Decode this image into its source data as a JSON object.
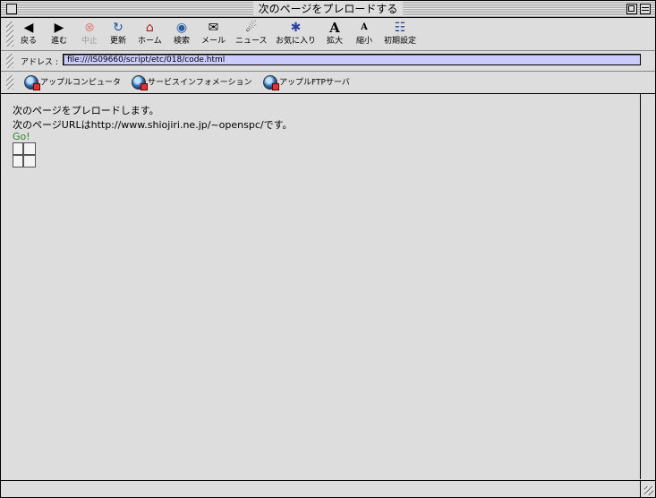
{
  "window": {
    "title": "次のページをプレロードする"
  },
  "toolbar": {
    "buttons": [
      {
        "label": "戻る",
        "icon": "back-arrow-icon",
        "glyph": "◀"
      },
      {
        "label": "進む",
        "icon": "forward-arrow-icon",
        "glyph": "▶"
      },
      {
        "label": "中止",
        "icon": "stop-icon",
        "glyph": "⊗"
      },
      {
        "label": "更新",
        "icon": "refresh-icon",
        "glyph": "↻"
      },
      {
        "label": "ホーム",
        "icon": "home-icon",
        "glyph": "⌂"
      },
      {
        "label": "検索",
        "icon": "search-globe-icon",
        "glyph": "◉"
      },
      {
        "label": "メール",
        "icon": "mail-icon",
        "glyph": "✉"
      },
      {
        "label": "ニュース",
        "icon": "news-icon",
        "glyph": "☄"
      },
      {
        "label": "お気に入り",
        "icon": "favorites-folder-icon",
        "glyph": "✱"
      },
      {
        "label": "拡大",
        "icon": "text-larger-icon",
        "glyph": "A"
      },
      {
        "label": "縮小",
        "icon": "text-smaller-icon",
        "glyph": "A"
      },
      {
        "label": "初期設定",
        "icon": "preferences-icon",
        "glyph": "☷"
      }
    ]
  },
  "address": {
    "label": "アドレス :",
    "value": "file:///IS09660/script/etc/018/code.html"
  },
  "favorites": [
    {
      "label": "アップルコンピュータ",
      "icon": "globe-icon"
    },
    {
      "label": "サービスインフォメーション",
      "icon": "globe-icon"
    },
    {
      "label": "アップルFTPサーバ",
      "icon": "globe-icon"
    }
  ],
  "content": {
    "line1": "次のページをプレロードします。",
    "line2": "次のページURLはhttp://www.shiojiri.ne.jp/~openspc/です。",
    "link": "Go!"
  }
}
